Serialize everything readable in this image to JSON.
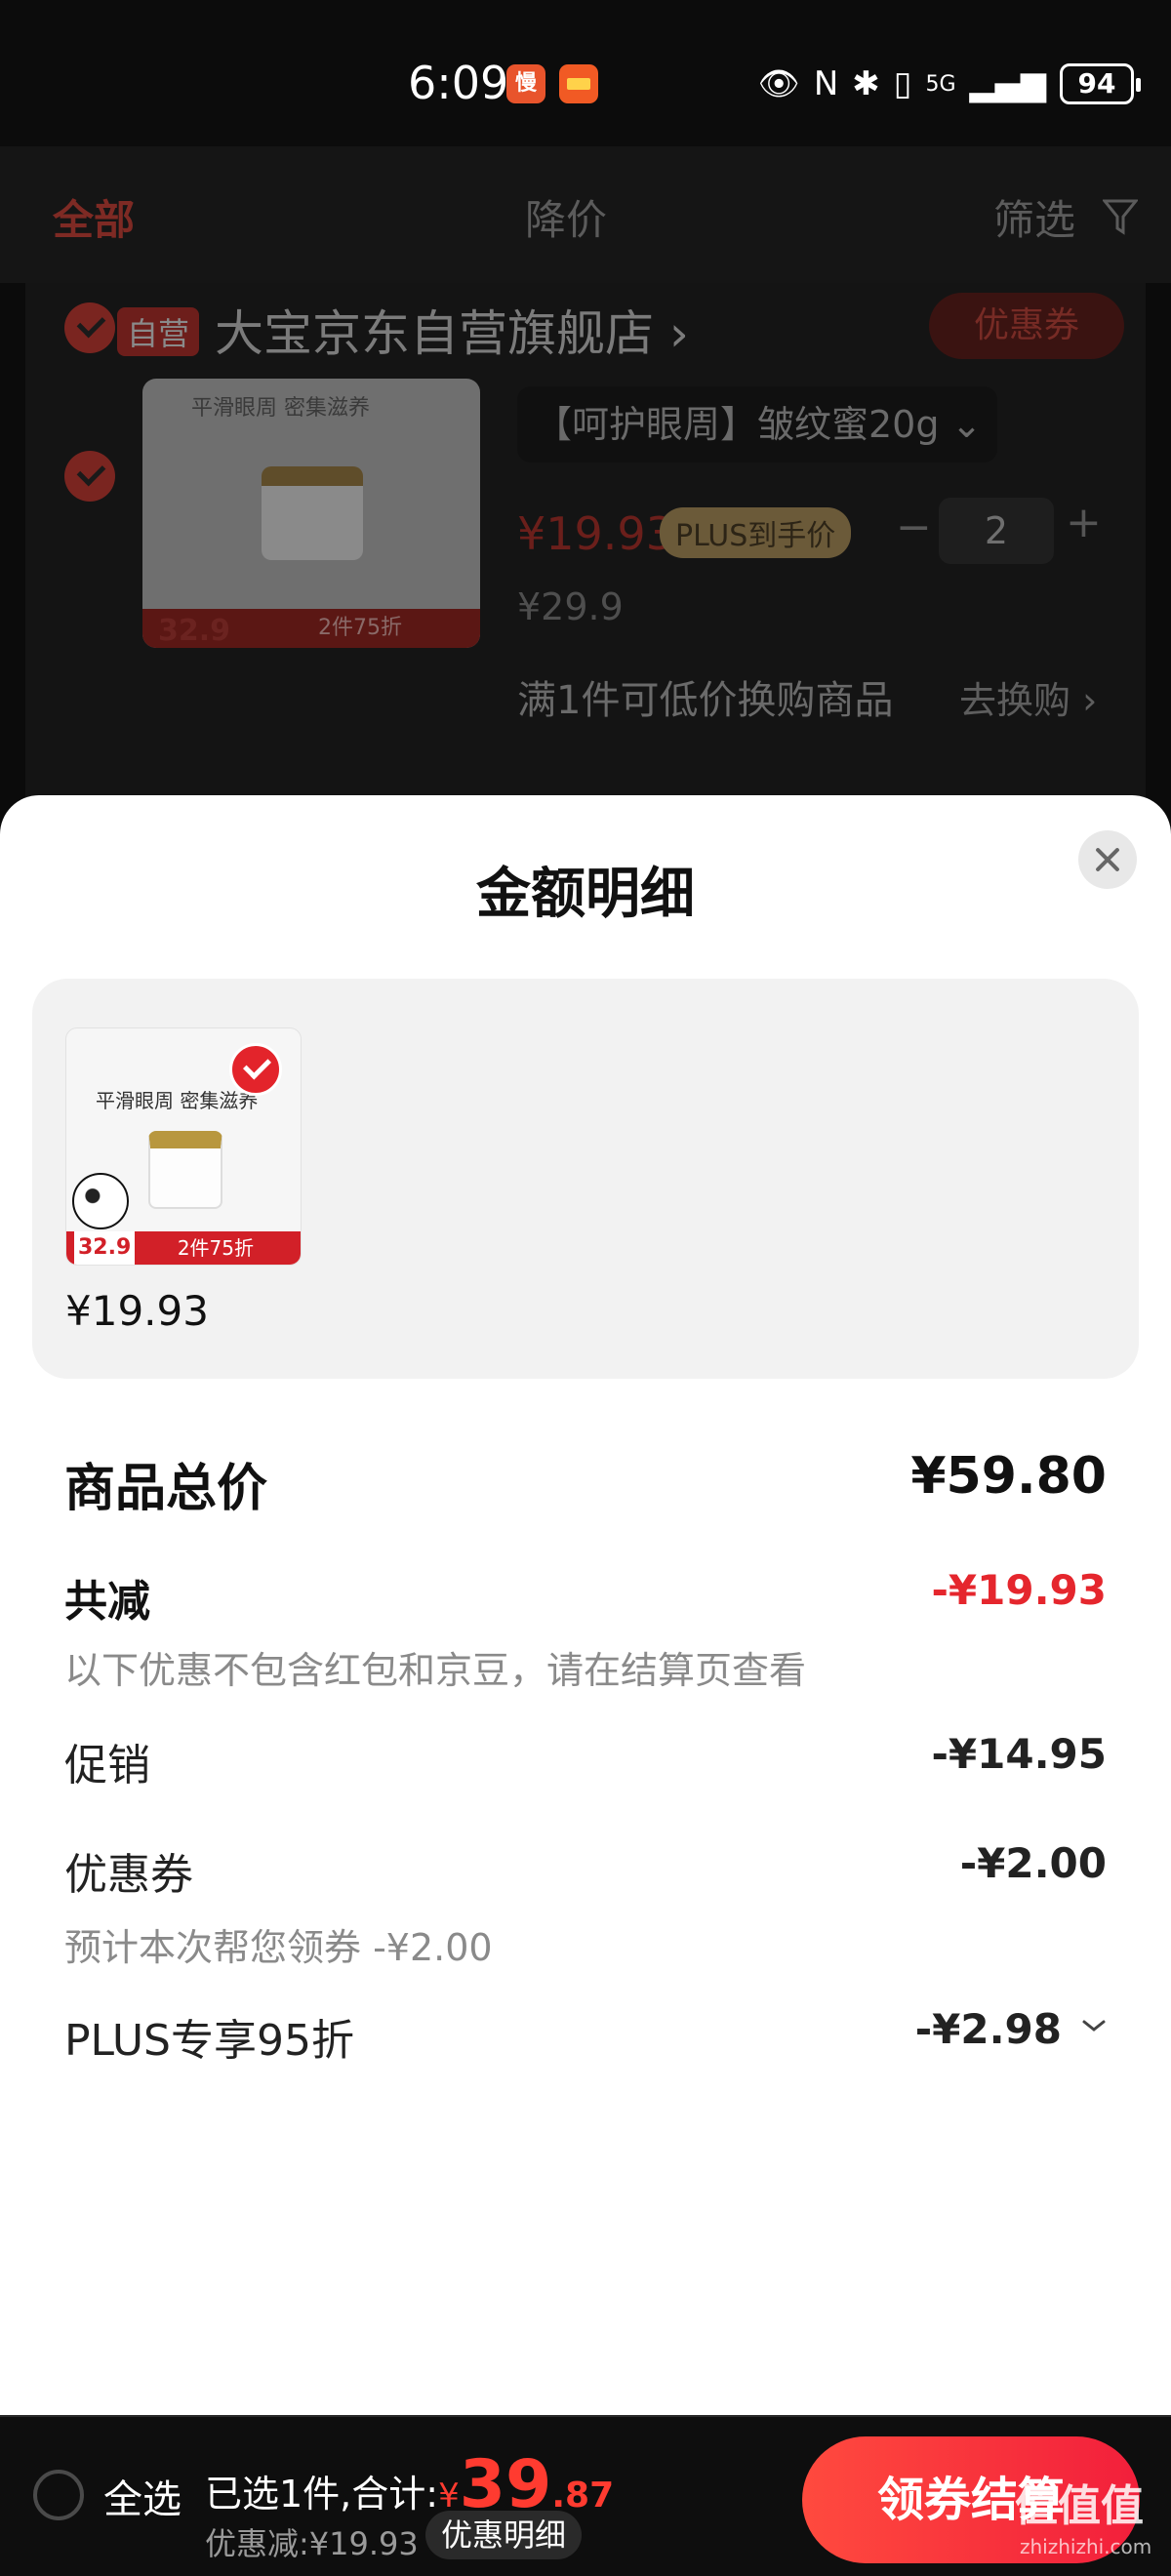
{
  "status_bar": {
    "time": "6:09",
    "app_badge_1": "慢",
    "network": "5G",
    "battery": "94"
  },
  "tabs": [
    {
      "label": "全部",
      "active": true
    },
    {
      "label": "降价",
      "active": false
    },
    {
      "label": "筛选",
      "active": false
    }
  ],
  "shop": {
    "tag": "自营",
    "name": "大宝京东自营旗舰店",
    "coupon": "优惠券",
    "product": {
      "image_slogan": "平滑眼周 密集滋养",
      "image_price": "32.9",
      "image_promo": "2件75折",
      "spec": "【呵护眼周】皱纹蜜20g",
      "price": "¥19.93",
      "plus_tag": "PLUS到手价",
      "quantity": "2",
      "original_price": "¥29.9",
      "swap_text": "满1件可低价换购商品",
      "swap_link": "去换购 ›"
    }
  },
  "sheet": {
    "title": "金额明细",
    "goods": {
      "image_slogan": "平滑眼周 密集滋养",
      "image_price": "32.9",
      "image_promo": "2件75折",
      "price": "¥19.93"
    },
    "total_label": "商品总价",
    "total_value": "¥59.80",
    "reduce_label": "共减",
    "reduce_value": "-¥19.93",
    "reduce_note": "以下优惠不包含红包和京豆，请在结算页查看",
    "promo_label": "促销",
    "promo_value": "-¥14.95",
    "coupon_label": "优惠券",
    "coupon_value": "-¥2.00",
    "coupon_note": "预计本次帮您领券 -¥2.00",
    "plus_label": "PLUS专享95折",
    "plus_value": "-¥2.98"
  },
  "bottom_bar": {
    "select_all": "全选",
    "summary_prefix": "已选1件,合计:",
    "currency": "¥",
    "amount_int": "39",
    "amount_dec": ".87",
    "discount_line": "优惠减:¥19.93",
    "detail_button": "优惠明细",
    "checkout_button": "领券结算"
  },
  "watermark": {
    "text": "值值值",
    "sub": "zhizhizhi.com"
  },
  "colors": {
    "accent_red": "#e5262d",
    "checkout_gradient_start": "#ff4a3e",
    "checkout_gradient_end": "#f21f3b"
  }
}
